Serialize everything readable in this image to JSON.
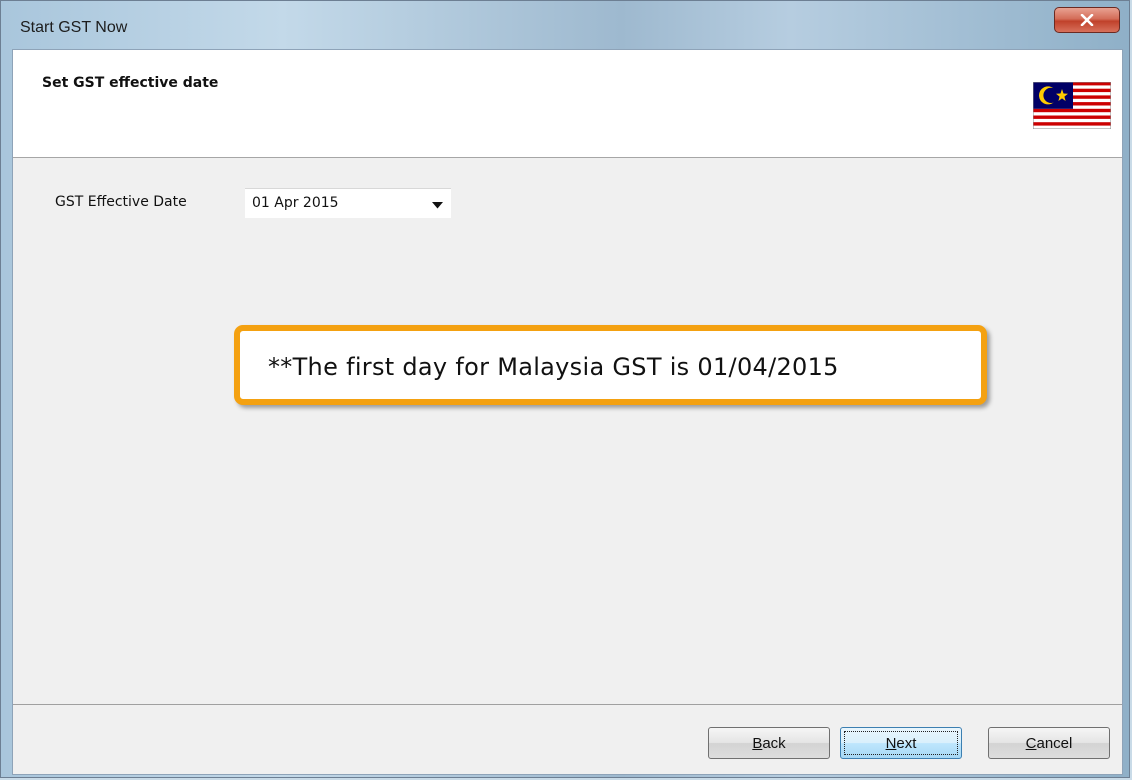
{
  "window": {
    "title": "Start GST Now",
    "close_icon": "close-icon"
  },
  "header": {
    "title": "Set GST effective date",
    "flag_icon": "malaysia-flag-icon"
  },
  "form": {
    "gst_effective_date": {
      "label": "GST Effective Date",
      "value": "01 Apr 2015",
      "dropdown_icon": "chevron-down-icon"
    }
  },
  "callout": {
    "text": "**The first day for Malaysia GST is 01/04/2015",
    "border_color": "#f4a111"
  },
  "buttons": {
    "back": "Back",
    "next": "Next",
    "cancel": "Cancel"
  },
  "colors": {
    "close_button": "#c0412b",
    "default_button": "#bee6fd",
    "callout_border": "#f4a111"
  }
}
